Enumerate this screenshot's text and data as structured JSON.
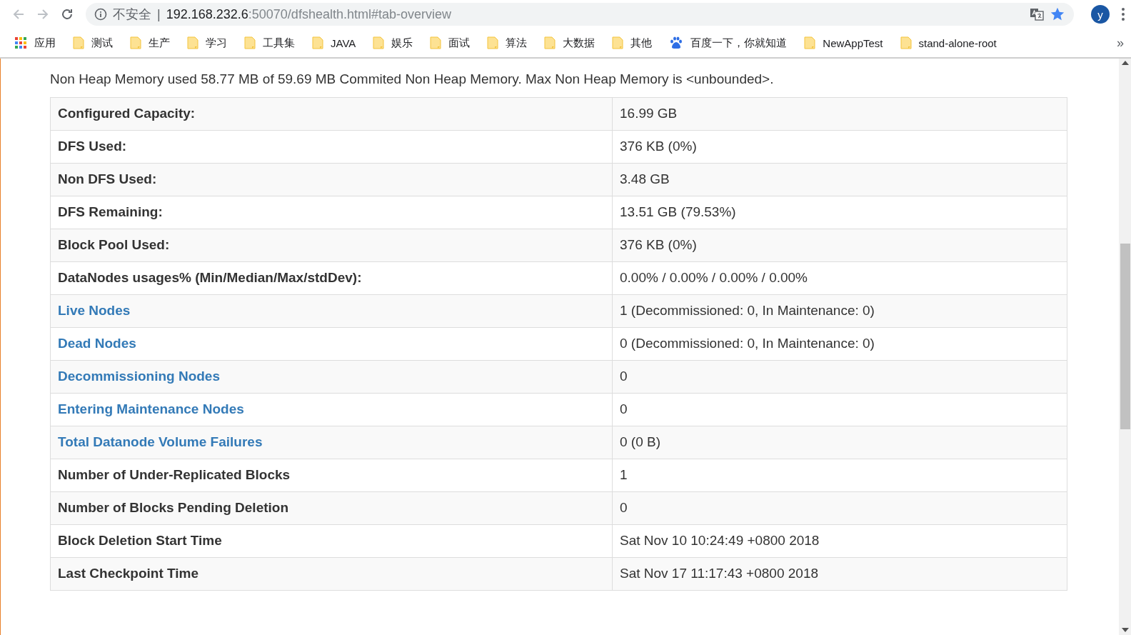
{
  "toolbar": {
    "security_label": "不安全",
    "separator": "|",
    "url_host": "192.168.232.6",
    "url_path": ":50070/dfshealth.html#tab-overview",
    "avatar_letter": "y"
  },
  "bookmarks": [
    {
      "kind": "apps",
      "label": "应用"
    },
    {
      "kind": "folder",
      "label": "测试"
    },
    {
      "kind": "folder",
      "label": "生产"
    },
    {
      "kind": "folder",
      "label": "学习"
    },
    {
      "kind": "folder",
      "label": "工具集"
    },
    {
      "kind": "folder",
      "label": "JAVA"
    },
    {
      "kind": "folder",
      "label": "娱乐"
    },
    {
      "kind": "folder",
      "label": "面试"
    },
    {
      "kind": "folder",
      "label": "算法"
    },
    {
      "kind": "folder",
      "label": "大数据"
    },
    {
      "kind": "folder",
      "label": "其他"
    },
    {
      "kind": "site",
      "label": "百度一下，你就知道"
    },
    {
      "kind": "folder",
      "label": "NewAppTest"
    },
    {
      "kind": "folder",
      "label": "stand-alone-root"
    }
  ],
  "bookmarks_more": "»",
  "memory_text": "Non Heap Memory used 58.77 MB of 59.69 MB Commited Non Heap Memory. Max Non Heap Memory is <unbounded>.",
  "table": {
    "rows": [
      {
        "kind": "label",
        "label": "Configured Capacity:",
        "value": "16.99 GB"
      },
      {
        "kind": "label",
        "label": "DFS Used:",
        "value": "376 KB (0%)"
      },
      {
        "kind": "label",
        "label": "Non DFS Used:",
        "value": "3.48 GB"
      },
      {
        "kind": "label",
        "label": "DFS Remaining:",
        "value": "13.51 GB (79.53%)"
      },
      {
        "kind": "label",
        "label": "Block Pool Used:",
        "value": "376 KB (0%)"
      },
      {
        "kind": "label",
        "label": "DataNodes usages% (Min/Median/Max/stdDev):",
        "value": "0.00% / 0.00% / 0.00% / 0.00%"
      },
      {
        "kind": "link",
        "label": "Live Nodes",
        "value": "1 (Decommissioned: 0, In Maintenance: 0)"
      },
      {
        "kind": "link",
        "label": "Dead Nodes",
        "value": "0 (Decommissioned: 0, In Maintenance: 0)"
      },
      {
        "kind": "link",
        "label": "Decommissioning Nodes",
        "value": "0"
      },
      {
        "kind": "link",
        "label": "Entering Maintenance Nodes",
        "value": "0"
      },
      {
        "kind": "link",
        "label": "Total Datanode Volume Failures",
        "value": "0 (0 B)"
      },
      {
        "kind": "label",
        "label": "Number of Under-Replicated Blocks",
        "value": "1"
      },
      {
        "kind": "label",
        "label": "Number of Blocks Pending Deletion",
        "value": "0"
      },
      {
        "kind": "label",
        "label": "Block Deletion Start Time",
        "value": "Sat Nov 10 10:24:49 +0800 2018"
      },
      {
        "kind": "label",
        "label": "Last Checkpoint Time",
        "value": "Sat Nov 17 11:17:43 +0800 2018"
      }
    ]
  }
}
